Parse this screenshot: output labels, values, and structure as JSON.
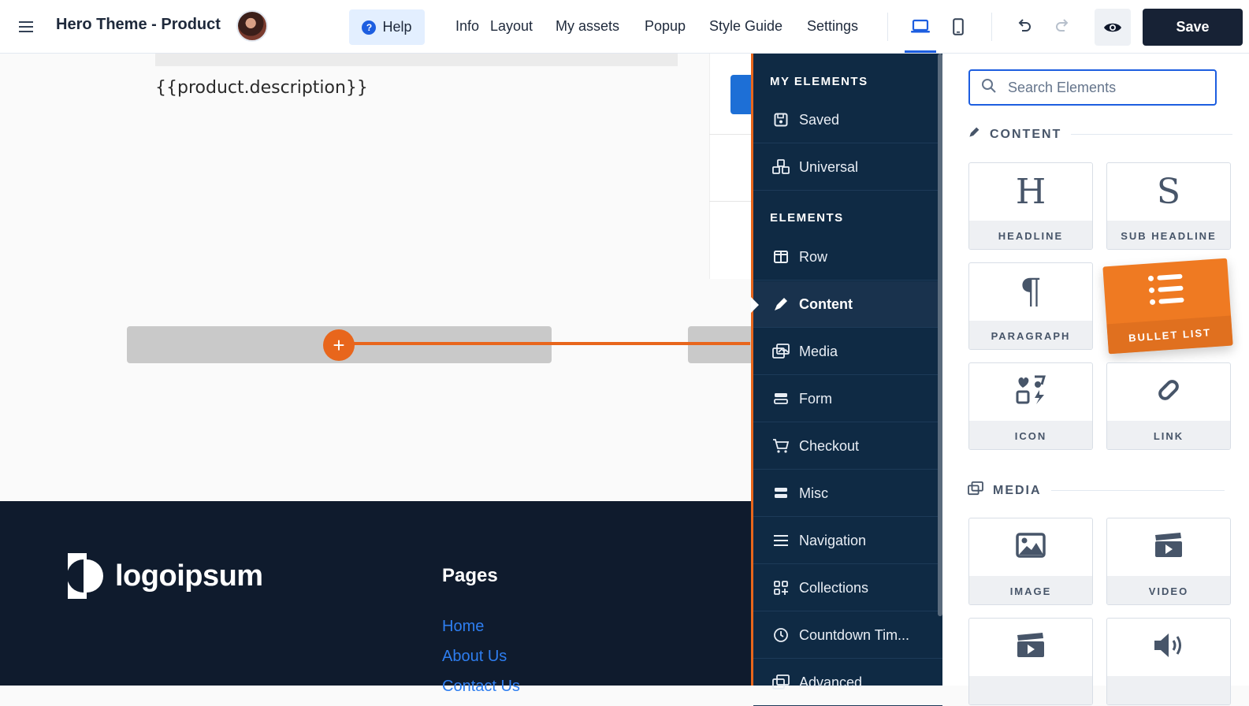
{
  "topbar": {
    "title": "Hero Theme - Product",
    "help_label": "Help",
    "nav": [
      "Info",
      "Layout",
      "My assets",
      "Popup",
      "Style Guide",
      "Settings"
    ],
    "save_label": "Save"
  },
  "canvas": {
    "description_placeholder": "{{product.description}}",
    "add_label": "+"
  },
  "footer": {
    "logo_text": "logoipsum",
    "pages_title": "Pages",
    "links": [
      "Home",
      "About Us",
      "Contact Us"
    ]
  },
  "sidebar": {
    "my_elements_heading": "MY ELEMENTS",
    "my_elements": [
      {
        "label": "Saved",
        "icon": "save-icon"
      },
      {
        "label": "Universal",
        "icon": "cubes-icon"
      }
    ],
    "elements_heading": "ELEMENTS",
    "elements": [
      {
        "label": "Row",
        "icon": "columns-icon"
      },
      {
        "label": "Content",
        "icon": "pen-icon",
        "active": true
      },
      {
        "label": "Media",
        "icon": "photo-film-icon"
      },
      {
        "label": "Form",
        "icon": "form-icon"
      },
      {
        "label": "Checkout",
        "icon": "cart-icon"
      },
      {
        "label": "Misc",
        "icon": "misc-icon"
      },
      {
        "label": "Navigation",
        "icon": "bars-icon"
      },
      {
        "label": "Collections",
        "icon": "grid-plus-icon"
      },
      {
        "label": "Countdown Tim...",
        "icon": "clock-icon"
      },
      {
        "label": "Advanced",
        "icon": "photo-film-icon"
      }
    ]
  },
  "panel": {
    "search_placeholder": "Search Elements",
    "content_heading": "CONTENT",
    "content_tiles": [
      {
        "label": "HEADLINE",
        "glyph": "H"
      },
      {
        "label": "SUB HEADLINE",
        "glyph": "S"
      },
      {
        "label": "PARAGRAPH",
        "glyph": "¶"
      },
      {
        "label": "BULLET LIST",
        "icon": "list-icon",
        "dragging": true
      },
      {
        "label": "ICON",
        "icon": "shapes-icon"
      },
      {
        "label": "LINK",
        "icon": "link-icon"
      }
    ],
    "media_heading": "MEDIA",
    "media_tiles": [
      {
        "label": "IMAGE",
        "icon": "image-icon"
      },
      {
        "label": "VIDEO",
        "icon": "clapperboard-icon"
      },
      {
        "label": "",
        "icon": "video-play-icon"
      },
      {
        "label": "",
        "icon": "volume-icon"
      }
    ]
  },
  "colors": {
    "accent": "#e8661c",
    "primary": "#1d5ee0",
    "sidebar_bg": "#0f2a44",
    "footer_bg": "#0f1b2d",
    "save_bg": "#172235",
    "link": "#2e7ef0"
  }
}
